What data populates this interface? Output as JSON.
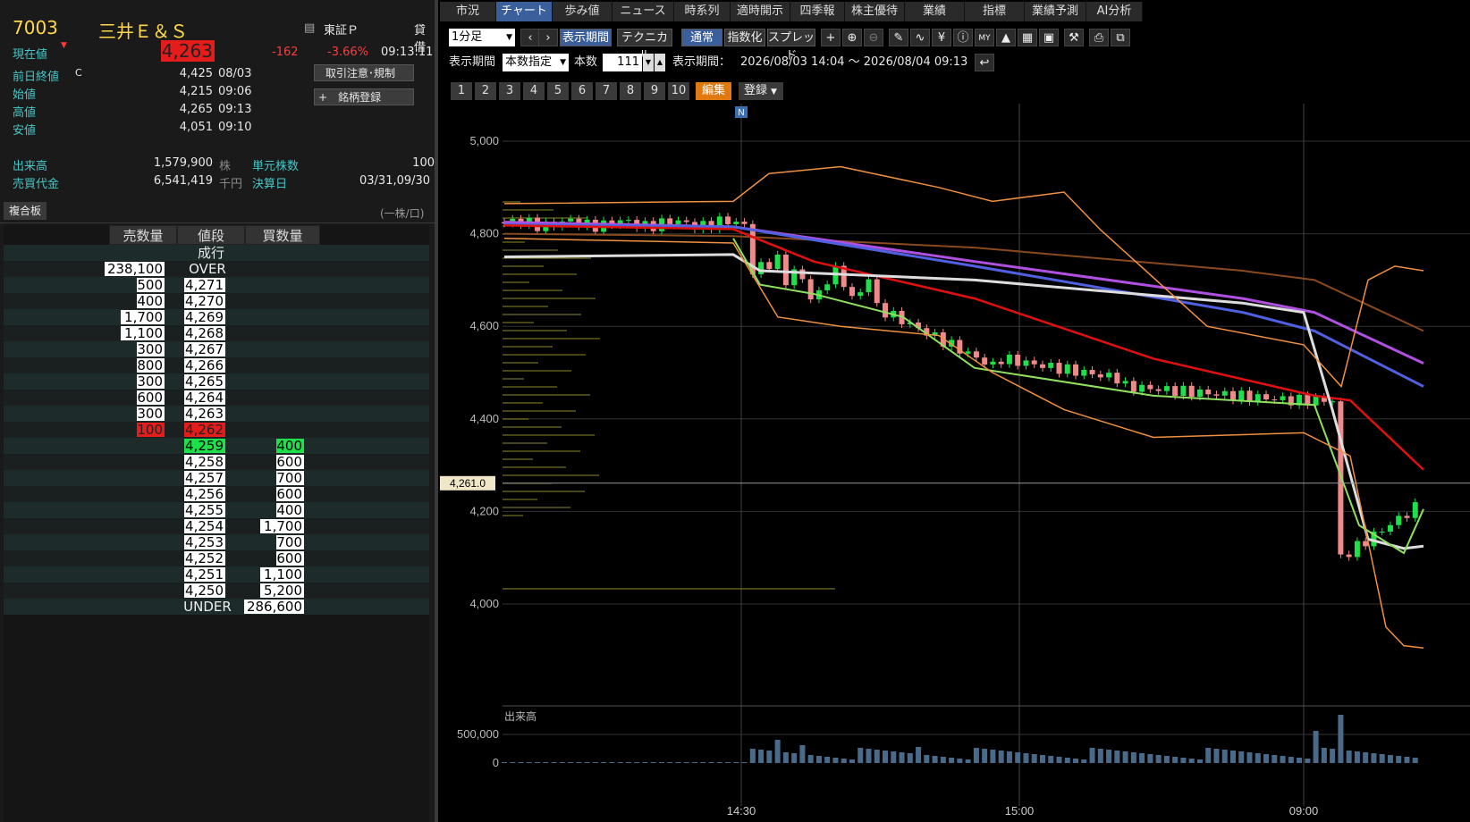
{
  "stock": {
    "code": "7003",
    "name": "三井Ｅ＆Ｓ",
    "market": "東証Ｐ",
    "margin": "貸借",
    "current_label": "現在値",
    "current_price": "4,263",
    "change": "-162",
    "change_pct": "-3.66%",
    "time": "09:13:11"
  },
  "quote": [
    {
      "label": "前日終値",
      "flag": "C",
      "value": "4,425",
      "time": "08/03"
    },
    {
      "label": "始値",
      "flag": "",
      "value": "4,215",
      "time": "09:06"
    },
    {
      "label": "高値",
      "flag": "",
      "value": "4,265",
      "time": "09:13"
    },
    {
      "label": "安値",
      "flag": "",
      "value": "4,051",
      "time": "09:10"
    }
  ],
  "stats": {
    "volume_label": "出来高",
    "volume": "1,579,900",
    "volume_unit": "株",
    "turnover_label": "売買代金",
    "turnover": "6,541,419",
    "turnover_unit": "千円",
    "unit_label": "単元株数",
    "unit": "100",
    "settle_label": "決算日",
    "settle": "03/31,09/30"
  },
  "buttons": {
    "notice": "取引注意･規制",
    "register": "銘柄登録",
    "register_icon": "+"
  },
  "board": {
    "tab": "複合板",
    "unit_note": "(一株/口)",
    "headers": [
      "売数量",
      "値段",
      "買数量"
    ],
    "market_order": "成行",
    "rows": [
      {
        "sell": "238,100",
        "price": "OVER",
        "buy": ""
      },
      {
        "sell": "500",
        "price": "4,271",
        "buy": ""
      },
      {
        "sell": "400",
        "price": "4,270",
        "buy": ""
      },
      {
        "sell": "1,700",
        "price": "4,269",
        "buy": ""
      },
      {
        "sell": "1,100",
        "price": "4,268",
        "buy": ""
      },
      {
        "sell": "300",
        "price": "4,267",
        "buy": ""
      },
      {
        "sell": "800",
        "price": "4,266",
        "buy": ""
      },
      {
        "sell": "300",
        "price": "4,265",
        "buy": ""
      },
      {
        "sell": "600",
        "price": "4,264",
        "buy": ""
      },
      {
        "sell": "300",
        "price": "4,263",
        "buy": ""
      },
      {
        "sell": "100",
        "price": "4,262",
        "buy": "",
        "hl": "sell"
      },
      {
        "sell": "",
        "price": "4,259",
        "buy": "400",
        "hl": "buy"
      },
      {
        "sell": "",
        "price": "4,258",
        "buy": "600"
      },
      {
        "sell": "",
        "price": "4,257",
        "buy": "700"
      },
      {
        "sell": "",
        "price": "4,256",
        "buy": "600"
      },
      {
        "sell": "",
        "price": "4,255",
        "buy": "400"
      },
      {
        "sell": "",
        "price": "4,254",
        "buy": "1,700"
      },
      {
        "sell": "",
        "price": "4,253",
        "buy": "700"
      },
      {
        "sell": "",
        "price": "4,252",
        "buy": "600"
      },
      {
        "sell": "",
        "price": "4,251",
        "buy": "1,100"
      },
      {
        "sell": "",
        "price": "4,250",
        "buy": "5,200"
      },
      {
        "sell": "",
        "price": "UNDER",
        "buy": "286,600"
      }
    ]
  },
  "tabs": [
    "市況",
    "チャート",
    "歩み値",
    "ニュース",
    "時系列",
    "適時開示",
    "四季報",
    "株主優待",
    "業績",
    "指標",
    "業績予測",
    "AI分析"
  ],
  "active_tab": "チャート",
  "toolbar": {
    "interval": "1分足",
    "display_period": "表示期間",
    "technical": "テクニカル",
    "normal": "通常",
    "index": "指数化",
    "spread": "スプレッド",
    "period_label": "表示期間",
    "period_mode": "本数指定",
    "count_label": "本数",
    "count": "111",
    "range_label": "表示期間：",
    "range": "2026/08/03 14:04 ～ 2026/08/04 09:13",
    "presets": [
      "1",
      "2",
      "3",
      "4",
      "5",
      "6",
      "7",
      "8",
      "9",
      "10"
    ],
    "edit": "編集",
    "register": "登録"
  },
  "colors": {
    "up": "#1ee04a",
    "down": "#f08a8a",
    "accent": "#3a5f9a",
    "edit": "#e07a10"
  },
  "chart_data": {
    "type": "candlestick",
    "y_ticks": [
      "5,000",
      "4,800",
      "4,600",
      "4,400",
      "4,200",
      "4,000"
    ],
    "x_ticks": [
      "14:30",
      "15:00",
      "09:00"
    ],
    "current_price_label": "4,261.0",
    "news_marker": "N",
    "volume_label": "出来高",
    "volume_tick": "500,000",
    "volume_zero": "0",
    "ylim": [
      3920,
      5050
    ],
    "grid": true
  }
}
